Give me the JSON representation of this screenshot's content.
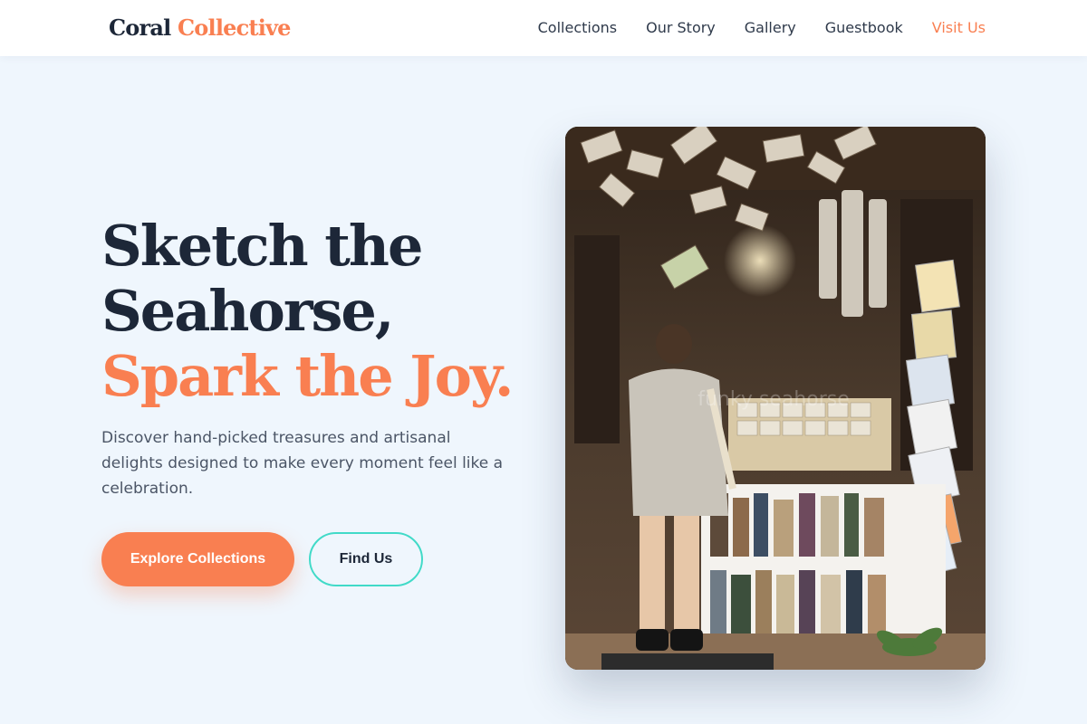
{
  "brand": {
    "name_part1": "Coral",
    "name_part2": "Collective"
  },
  "nav": {
    "items": [
      {
        "label": "Collections"
      },
      {
        "label": "Our Story"
      },
      {
        "label": "Gallery"
      },
      {
        "label": "Guestbook"
      },
      {
        "label": "Visit Us"
      }
    ]
  },
  "hero": {
    "headline_line1": "Sketch the",
    "headline_line2": "Seahorse,",
    "headline_accent": "Spark the Joy.",
    "description": "Discover hand-picked treasures and artisanal delights designed to make every moment feel like a celebration.",
    "primary_cta": "Explore Collections",
    "secondary_cta": "Find Us",
    "image_watermark": "funky seahorse"
  },
  "colors": {
    "accent": "#f97f51",
    "outline_accent": "#41dac8",
    "heading": "#1d2738",
    "background": "#eff6fd"
  }
}
